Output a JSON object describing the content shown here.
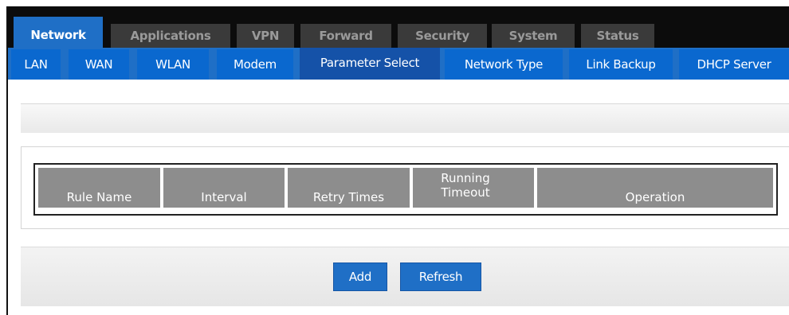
{
  "main_tabs": [
    {
      "label": "Network",
      "active": true
    },
    {
      "label": "Applications",
      "active": false
    },
    {
      "label": "VPN",
      "active": false
    },
    {
      "label": "Forward",
      "active": false
    },
    {
      "label": "Security",
      "active": false
    },
    {
      "label": "System",
      "active": false
    },
    {
      "label": "Status",
      "active": false
    }
  ],
  "sub_tabs": [
    {
      "label": "LAN",
      "active": false
    },
    {
      "label": "WAN",
      "active": false
    },
    {
      "label": "WLAN",
      "active": false
    },
    {
      "label": "Modem",
      "active": false
    },
    {
      "label": "Parameter Select",
      "active": true
    },
    {
      "label": "Network Type",
      "active": false
    },
    {
      "label": "Link Backup",
      "active": false
    },
    {
      "label": "DHCP Server",
      "active": false
    }
  ],
  "table": {
    "headers": [
      "Rule Name",
      "Interval",
      "Retry Times",
      "Running Timeout",
      "Operation"
    ],
    "rows": []
  },
  "buttons": {
    "add_label": "Add",
    "refresh_label": "Refresh"
  },
  "colors": {
    "accent": "#1f6fc6",
    "active_subtab": "#1552a8",
    "header_bar": "#0c0c0c",
    "table_header": "#8d8d8d"
  }
}
